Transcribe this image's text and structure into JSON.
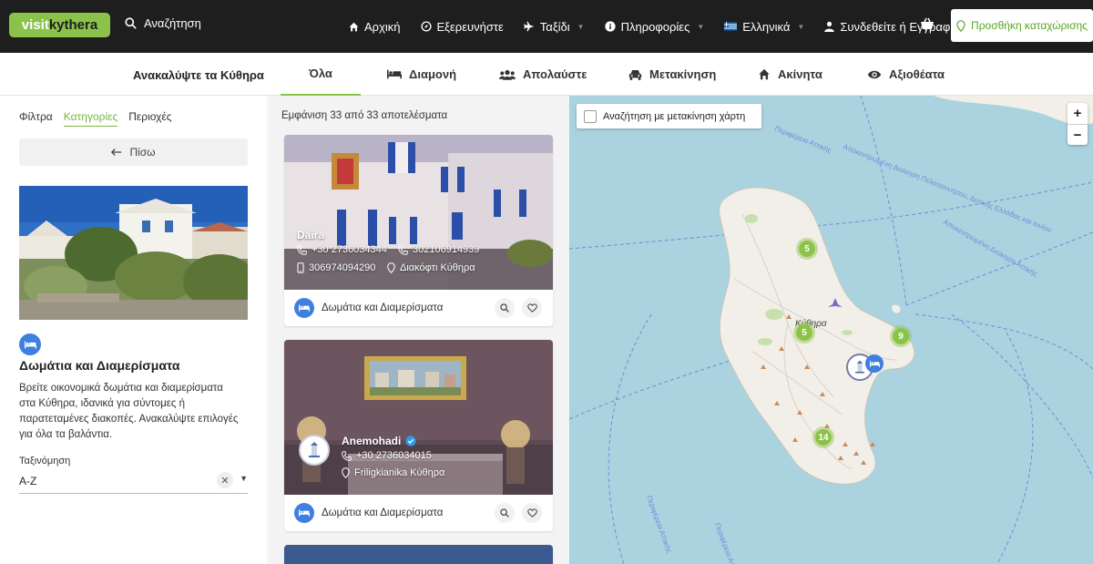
{
  "header": {
    "logo_left": "visit",
    "logo_right": "kythera",
    "search_label": "Αναζήτηση",
    "nav": [
      {
        "label": "Αρχική",
        "icon": "home-icon",
        "dropdown": false
      },
      {
        "label": "Εξερευνήστε",
        "icon": "compass-icon",
        "dropdown": false
      },
      {
        "label": "Ταξίδι",
        "icon": "plane-icon",
        "dropdown": true
      },
      {
        "label": "Πληροφορίες",
        "icon": "info-icon",
        "dropdown": true
      },
      {
        "label": "Ελληνικά",
        "icon": "greek-flag-icon",
        "dropdown": true
      },
      {
        "label": "Συνδεθείτε ή Εγγραφή",
        "icon": "user-icon",
        "dropdown": false
      }
    ],
    "cart_icon": "cart-icon",
    "add_listing_label": "Προσθήκη καταχώρισης",
    "brand_color": "#8bc34a"
  },
  "categories": {
    "title": "Ανακαλύψτε τα Κύθηρα",
    "tabs": [
      {
        "label": "Όλα",
        "icon": "",
        "active": true
      },
      {
        "label": "Διαμονή",
        "icon": "bed-icon",
        "active": false
      },
      {
        "label": "Απολαύστε",
        "icon": "users-icon",
        "active": false
      },
      {
        "label": "Μετακίνηση",
        "icon": "car-icon",
        "active": false
      },
      {
        "label": "Ακίνητα",
        "icon": "house-icon",
        "active": false
      },
      {
        "label": "Αξιοθέατα",
        "icon": "eye-icon",
        "active": false
      }
    ]
  },
  "sidebar": {
    "tabs": [
      {
        "label": "Φίλτρα",
        "active": false
      },
      {
        "label": "Κατηγορίες",
        "active": true
      },
      {
        "label": "Περιοχές",
        "active": false
      }
    ],
    "back_label": "Πίσω",
    "category_title": "Δωμάτια και Διαμερίσματα",
    "category_description": "Βρείτε οικονομικά δωμάτια και διαμερίσματα στα Κύθηρα, ιδανικά για σύντομες ή παρατεταμένες διακοπές. Ανακαλύψτε επιλογές για όλα τα βαλάντια.",
    "sort_label": "Ταξινόμηση",
    "sort_value": "A-Z"
  },
  "results": {
    "count_text": "Εμφάνιση 33 από 33 αποτελέσματα",
    "listings": [
      {
        "name": "Daira",
        "phone1": "+30 2736034344",
        "phone2": "302106914939",
        "mobile": "306974094290",
        "location": "Διακόφτι Κύθηρα",
        "category": "Δωμάτια και Διαμερίσματα",
        "verified": false
      },
      {
        "name": "Anemohadi",
        "phone1": "+30 2736034015",
        "location": "Friligkianika Κύθηρα",
        "category": "Δωμάτια και Διαμερίσματα",
        "verified": true
      }
    ]
  },
  "map": {
    "search_on_move_label": "Αναζήτηση με μετακίνηση χάρτη",
    "zoom_in": "+",
    "zoom_out": "−",
    "island_label": "Κύθηρα",
    "clusters": [
      "5",
      "5",
      "9",
      "14"
    ],
    "sea_color": "#aad3df",
    "land_color": "#f2efe9"
  }
}
